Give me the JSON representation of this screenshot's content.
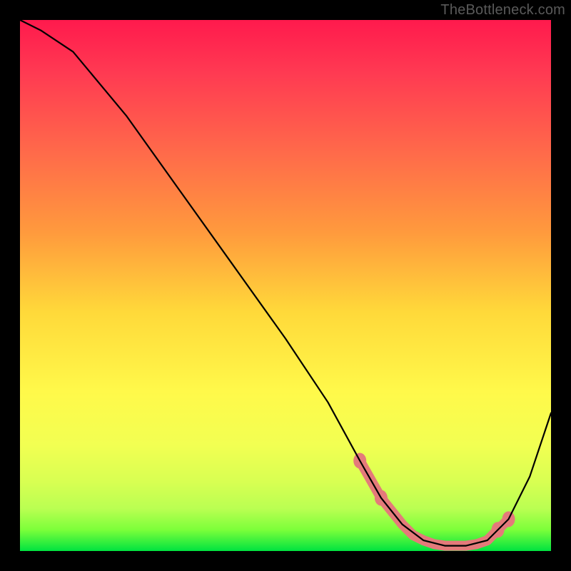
{
  "watermark": "TheBottleneck.com",
  "chart_data": {
    "type": "line",
    "title": "",
    "xlabel": "",
    "ylabel": "",
    "xlim": [
      0,
      100
    ],
    "ylim": [
      0,
      100
    ],
    "series": [
      {
        "name": "bottleneck-curve",
        "x": [
          0,
          4,
          10,
          20,
          30,
          40,
          50,
          58,
          64,
          68,
          72,
          76,
          80,
          84,
          88,
          92,
          96,
          100
        ],
        "y": [
          100,
          98,
          94,
          82,
          68,
          54,
          40,
          28,
          17,
          10,
          5,
          2,
          1,
          1,
          2,
          6,
          14,
          26
        ]
      }
    ],
    "markers": {
      "name": "highlight-region",
      "x": [
        64,
        68,
        72,
        74,
        76,
        78,
        80,
        82,
        84,
        86,
        88,
        90,
        92
      ],
      "y": [
        17,
        10,
        5,
        3,
        2,
        1.3,
        1,
        1,
        1,
        1.3,
        2,
        4,
        6
      ]
    },
    "colors": {
      "curve": "#000000",
      "markers": "#e47a7a",
      "gradient_top": "#ff1a4d",
      "gradient_mid": "#ffd93a",
      "gradient_bottom": "#00e340",
      "background": "#000000"
    }
  }
}
